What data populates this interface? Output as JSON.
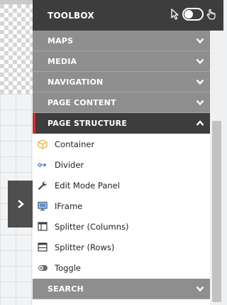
{
  "toolbox": {
    "title": "TOOLBOX",
    "sections_before": [
      {
        "label": "MAPS"
      },
      {
        "label": "MEDIA"
      },
      {
        "label": "NAVIGATION"
      },
      {
        "label": "PAGE CONTENT"
      }
    ],
    "active_section": {
      "label": "PAGE STRUCTURE",
      "items": [
        {
          "label": "Container",
          "icon": "box-icon"
        },
        {
          "label": "Divider",
          "icon": "divider-icon"
        },
        {
          "label": "Edit Mode Panel",
          "icon": "wrench-icon"
        },
        {
          "label": "IFrame",
          "icon": "monitor-icon"
        },
        {
          "label": "Splitter (Columns)",
          "icon": "splitter-columns-icon"
        },
        {
          "label": "Splitter (Rows)",
          "icon": "splitter-rows-icon"
        },
        {
          "label": "Toggle",
          "icon": "toggle-icon"
        }
      ]
    },
    "sections_after": [
      {
        "label": "SEARCH"
      }
    ]
  },
  "colors": {
    "header_bg": "#3d3d3d",
    "section_bg": "#8e8e8e",
    "accent": "#d42b2b",
    "item_icon": "#3f6fb5",
    "container_icon": "#e8a93a"
  }
}
